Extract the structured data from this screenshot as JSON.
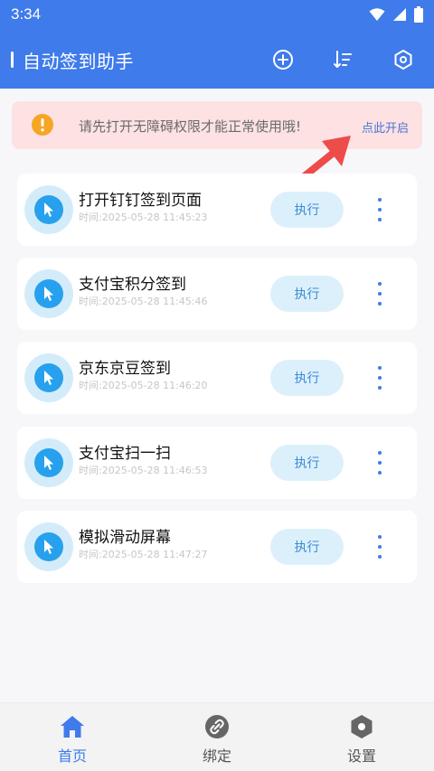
{
  "status_bar": {
    "time": "3:34"
  },
  "app_bar": {
    "title": "自动签到助手"
  },
  "notice": {
    "text": "请先打开无障碍权限才能正常使用哦!",
    "link": "点此开启"
  },
  "tasks": [
    {
      "name": "打开钉钉签到页面",
      "time": "时间:2025-05-28 11:45:23",
      "run_label": "执行"
    },
    {
      "name": "支付宝积分签到",
      "time": "时间:2025-05-28 11:45:46",
      "run_label": "执行"
    },
    {
      "name": "京东京豆签到",
      "time": "时间:2025-05-28 11:46:20",
      "run_label": "执行"
    },
    {
      "name": "支付宝扫一扫",
      "time": "时间:2025-05-28 11:46:53",
      "run_label": "执行"
    },
    {
      "name": "模拟滑动屏幕",
      "time": "时间:2025-05-28 11:47:27",
      "run_label": "执行"
    }
  ],
  "bottom_nav": [
    {
      "label": "首页",
      "icon": "home-icon",
      "active": true
    },
    {
      "label": "绑定",
      "icon": "link-icon",
      "active": false
    },
    {
      "label": "设置",
      "icon": "settings-icon",
      "active": false
    }
  ],
  "colors": {
    "primary": "#3f7bea",
    "notice_bg": "#fde1e3",
    "run_button_bg": "#dcf0fc",
    "task_icon": "#27a1ee",
    "warning": "#f5a623",
    "arrow": "#ee4b4b"
  }
}
